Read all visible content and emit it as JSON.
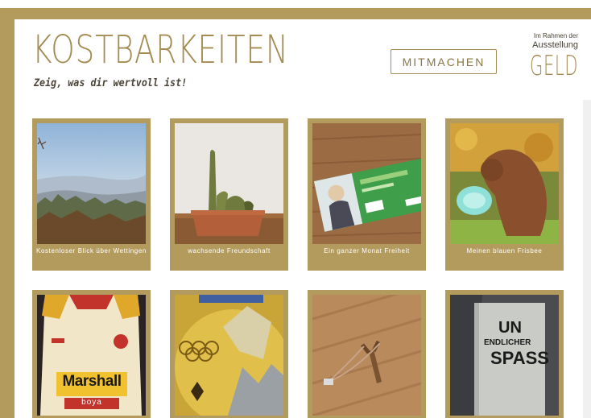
{
  "header": {
    "title": "KOSTBARKEITEN",
    "subtitle": "Zeig, was dir wertvoll ist!",
    "cta_label": "MITMACHEN",
    "exhibition_intro_line1": "Im Rahmen der",
    "exhibition_intro_line2": "Ausstellung",
    "exhibition_name": "GELD"
  },
  "colors": {
    "gold": "#b39b5e",
    "gold_text": "#a48c52",
    "dark_text": "#4a4337"
  },
  "cards": [
    {
      "caption": "Kostenloser Blick über Wettingen",
      "image": "landscape-photo"
    },
    {
      "caption": "wachsende Freundschaft",
      "image": "cactus-photo"
    },
    {
      "caption": "Ein ganzer Monat Freiheit",
      "image": "travel-pass-photo"
    },
    {
      "caption": "Meinen blauen Frisbee",
      "image": "dog-frisbee-photo"
    },
    {
      "caption": "",
      "image": "football-jersey-photo"
    },
    {
      "caption": "",
      "image": "gold-medal-photo"
    },
    {
      "caption": "",
      "image": "slingshot-photo"
    },
    {
      "caption": "",
      "image": "book-photo"
    }
  ],
  "photo_text": {
    "jersey_brand": "Marshall",
    "jersey_sponsor": "boya",
    "book_title_1": "UN",
    "book_title_2": "ENDLICHER",
    "book_title_3": "SPASS"
  }
}
